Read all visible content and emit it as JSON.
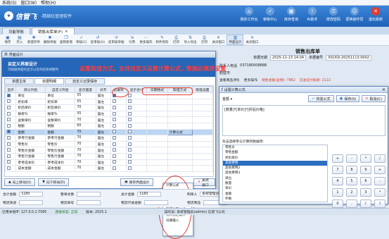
{
  "menu": [
    "系统(S)",
    "窗口(W)",
    "帮助(H)"
  ],
  "app": {
    "name": "信管飞",
    "slogan": "-精细化管理软件"
  },
  "topnav": [
    {
      "label": "我的工作台",
      "icon": "home-icon"
    },
    {
      "label": "审核中心",
      "icon": "check-icon"
    },
    {
      "label": "库存查询",
      "icon": "box-icon"
    },
    {
      "label": "AI助手",
      "icon": "info-icon"
    },
    {
      "label": "修改密码",
      "icon": "lock-icon"
    },
    {
      "label": "更换操作员",
      "icon": "user-icon"
    },
    {
      "label": "退出系统",
      "icon": "close-icon"
    }
  ],
  "tabs": [
    {
      "label": "功能导航"
    },
    {
      "label": "销售出库单(F)"
    }
  ],
  "toolbar": [
    "保存",
    "存入",
    "新建开单",
    "删除单据",
    "复制新增",
    "审核(C)",
    "反审核(U)",
    "反审核单据",
    "引用",
    "更多操作",
    "附件资料",
    "打印",
    "导入导出",
    "打印",
    "关闭窗口",
    "界面设计",
    "关闭窗口"
  ],
  "doc": {
    "title": "销售出库单",
    "date_label": "单据日期",
    "date": "2025-11-13 14:04",
    "no_label": "单据编号",
    "no": "XSCKD-20251113-0002"
  },
  "dlg1": {
    "title": "界面设计",
    "banner_title": "自定义界面设计",
    "banner_sub": "可根据界面的显示以及列名称调整列",
    "annotation": "设置取值方式，支持自定义设置计算公式，数据必填项设置",
    "subtabs": [
      "单据主体",
      "单据明细",
      "自定义记录保存"
    ],
    "columns": [
      "显示",
      "默认列名",
      "自定义列名",
      "显示宽度",
      "对齐",
      "必填项",
      "显示合计",
      "日期格式",
      "取值方式",
      "取值设置"
    ],
    "rows": [
      {
        "show": true,
        "name": "单位",
        "custom": "单位",
        "width": "55",
        "align": "居左",
        "req": true,
        "sum": false,
        "val": ""
      },
      {
        "show": false,
        "name": "折扣率",
        "custom": "折扣率",
        "width": "55",
        "align": "居左",
        "req": false,
        "sum": false,
        "val": ""
      },
      {
        "show": false,
        "name": "折后单价",
        "custom": "折后单价",
        "width": "70",
        "align": "居左",
        "req": false,
        "sum": false,
        "val": ""
      },
      {
        "show": false,
        "name": "税率%",
        "custom": "税率%",
        "width": "55",
        "align": "居左",
        "req": false,
        "sum": false,
        "val": ""
      },
      {
        "show": false,
        "name": "含税单价",
        "custom": "含税单价",
        "width": "70",
        "align": "居左",
        "req": false,
        "sum": false,
        "val": ""
      },
      {
        "show": false,
        "name": "税额",
        "custom": "税额",
        "width": "60",
        "align": "居左",
        "req": false,
        "sum": false,
        "val": ""
      },
      {
        "show": true,
        "name": "金额",
        "custom": "金额",
        "width": "70",
        "align": "居左",
        "req": false,
        "sum": false,
        "val": "计算公式",
        "hl": true
      },
      {
        "show": false,
        "name": "参考行金额",
        "custom": "参考行金额",
        "width": "70",
        "align": "居左",
        "req": false,
        "sum": false,
        "val": ""
      },
      {
        "show": false,
        "name": "零售价",
        "custom": "零售价",
        "width": "70",
        "align": "居左",
        "req": false,
        "sum": false,
        "val": ""
      },
      {
        "show": false,
        "name": "零售价金额",
        "custom": "零售价金额",
        "width": "70",
        "align": "居左",
        "req": false,
        "sum": false,
        "val": ""
      },
      {
        "show": false,
        "name": "零售行金额",
        "custom": "零售行金额",
        "width": "70",
        "align": "居左",
        "req": false,
        "sum": false,
        "val": ""
      },
      {
        "show": false,
        "name": "参考成本价",
        "custom": "参考成本价",
        "width": "70",
        "align": "居左",
        "req": false,
        "sum": false,
        "val": ""
      },
      {
        "show": false,
        "name": "成本金额",
        "custom": "成本金额",
        "width": "70",
        "align": "居左",
        "req": false,
        "sum": false,
        "val": ""
      }
    ],
    "menu": [
      "计算公式",
      "基础资料",
      "数据字典",
      "计算公式",
      "取得计算公式",
      "统计总汇输入",
      "日期输入"
    ],
    "menu_selected": 3,
    "btn_up": "向上移动(U)",
    "btn_down": "向下移动(D)",
    "btn_save": "保存界面设计",
    "btn_close": "关闭窗口"
  },
  "right": {
    "contact_label": "联系人电话",
    "contact": "037180008888",
    "addr": "鹤壁市",
    "tabs": [
      "查看商品评价",
      "更多操作"
    ],
    "amount_label": "销售金额(含税): 7862",
    "remark": "应收应付账款: 2122"
  },
  "dlg2": {
    "title": "设置计算公式",
    "field": "金额",
    "btn_check": "校验公式",
    "btn_save": "保存(S)",
    "btn_cancel": "取消(C)",
    "expression": "[数量]*[单价]*[折后价格]",
    "list_label": "双击选择参与计算的数据项:",
    "list": [
      "零售价",
      "零售金额",
      "折扣单价",
      "其他费用",
      "其他费用2",
      "其他费用3",
      "单位",
      "数量",
      "单价",
      "金额",
      "件数"
    ],
    "list_selected": 3,
    "keys": [
      "+",
      "-",
      "*",
      "/",
      "7",
      "8",
      "9",
      "+",
      "4",
      "5",
      "6",
      "-",
      "1",
      "2",
      "3",
      "*",
      "0",
      ".",
      "(",
      ")"
    ]
  },
  "summary": {
    "total_qty_label": "合计金额",
    "total_qty": "1180",
    "paid_label": "整单优惠",
    "total_label": "总计金额",
    "total": "1180",
    "order_label": "订单",
    "creator_label": "制单人",
    "creator": "系统管理员",
    "note_label": "物流快递",
    "ship_label": "物流单号",
    "fee_label": "物流运费",
    "fee2_label": "物流代收金额",
    "c_label": "物流商品"
  },
  "status": {
    "ip": "已用本地IP: 127.0.0.1:7095",
    "link": "连接状态: 正常",
    "ver": "版本: 2025.1",
    "user": "操作员: 系统管理员(admin) 信管飞公司"
  }
}
